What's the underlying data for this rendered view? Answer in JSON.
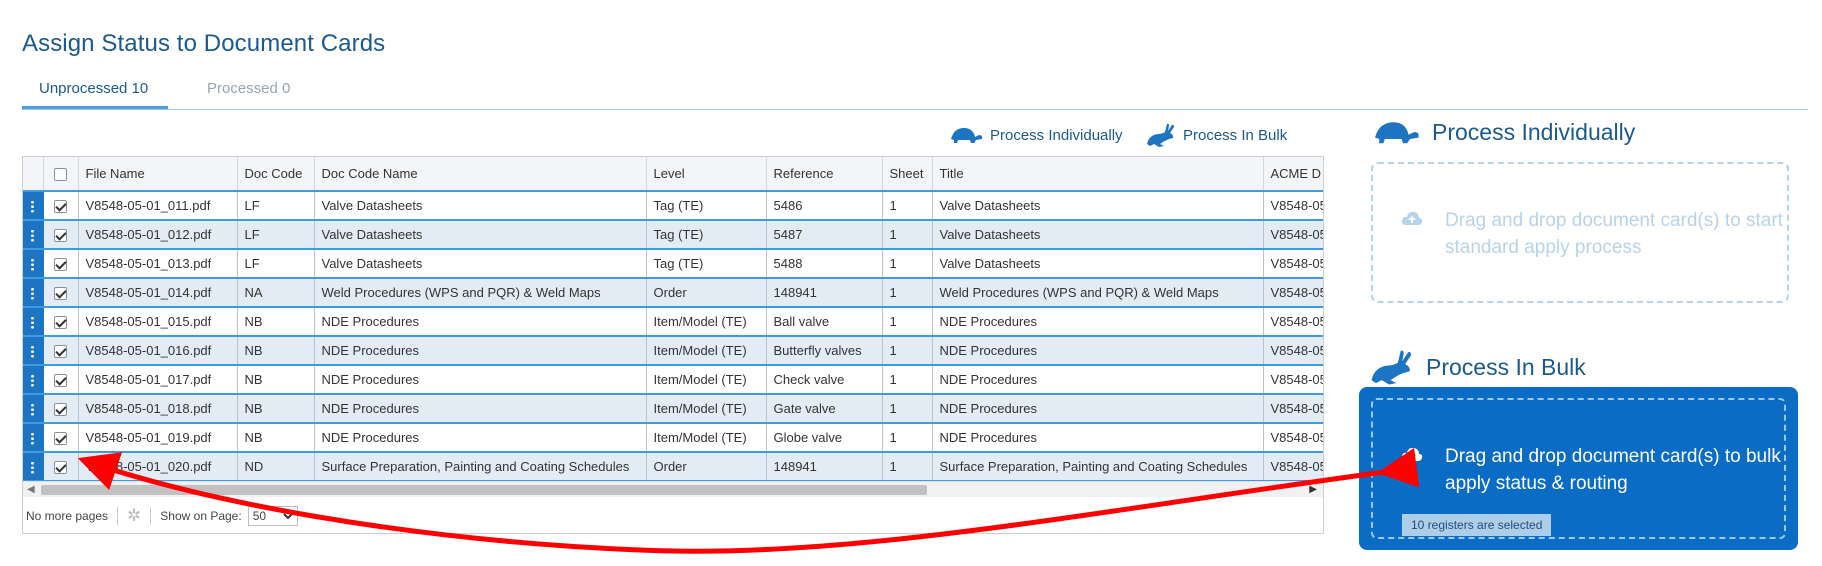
{
  "page": {
    "title": "Assign Status to Document Cards"
  },
  "tabs": [
    {
      "label": "Unprocessed 10",
      "active": true
    },
    {
      "label": "Processed 0",
      "active": false
    }
  ],
  "toolbar": {
    "process_individually": "Process Individually",
    "process_in_bulk": "Process In Bulk"
  },
  "grid": {
    "columns": [
      "File Name",
      "Doc Code",
      "Doc Code Name",
      "Level",
      "Reference",
      "Sheet",
      "Title",
      "ACME D"
    ],
    "rows": [
      {
        "file": "V8548-05-01_011.pdf",
        "code": "LF",
        "code_name": "Valve Datasheets",
        "level": "Tag (TE)",
        "reference": "5486",
        "sheet": "1",
        "title": "Valve Datasheets",
        "acme": "V8548-05"
      },
      {
        "file": "V8548-05-01_012.pdf",
        "code": "LF",
        "code_name": "Valve Datasheets",
        "level": "Tag (TE)",
        "reference": "5487",
        "sheet": "1",
        "title": "Valve Datasheets",
        "acme": "V8548-05"
      },
      {
        "file": "V8548-05-01_013.pdf",
        "code": "LF",
        "code_name": "Valve Datasheets",
        "level": "Tag (TE)",
        "reference": "5488",
        "sheet": "1",
        "title": "Valve Datasheets",
        "acme": "V8548-05"
      },
      {
        "file": "V8548-05-01_014.pdf",
        "code": "NA",
        "code_name": "Weld Procedures (WPS and PQR) & Weld Maps",
        "level": "Order",
        "reference": "148941",
        "sheet": "1",
        "title": "Weld Procedures (WPS and PQR) & Weld Maps",
        "acme": "V8548-05"
      },
      {
        "file": "V8548-05-01_015.pdf",
        "code": "NB",
        "code_name": "NDE Procedures",
        "level": "Item/Model (TE)",
        "reference": "Ball valve",
        "sheet": "1",
        "title": "NDE Procedures",
        "acme": "V8548-05"
      },
      {
        "file": "V8548-05-01_016.pdf",
        "code": "NB",
        "code_name": "NDE Procedures",
        "level": "Item/Model (TE)",
        "reference": "Butterfly valves",
        "sheet": "1",
        "title": "NDE Procedures",
        "acme": "V8548-05"
      },
      {
        "file": "V8548-05-01_017.pdf",
        "code": "NB",
        "code_name": "NDE Procedures",
        "level": "Item/Model (TE)",
        "reference": "Check valve",
        "sheet": "1",
        "title": "NDE Procedures",
        "acme": "V8548-05"
      },
      {
        "file": "V8548-05-01_018.pdf",
        "code": "NB",
        "code_name": "NDE Procedures",
        "level": "Item/Model (TE)",
        "reference": "Gate valve",
        "sheet": "1",
        "title": "NDE Procedures",
        "acme": "V8548-05"
      },
      {
        "file": "V8548-05-01_019.pdf",
        "code": "NB",
        "code_name": "NDE Procedures",
        "level": "Item/Model (TE)",
        "reference": "Globe valve",
        "sheet": "1",
        "title": "NDE Procedures",
        "acme": "V8548-05"
      },
      {
        "file": "V8548-05-01_020.pdf",
        "code": "ND",
        "code_name": "Surface Preparation, Painting and Coating Schedules",
        "level": "Order",
        "reference": "148941",
        "sheet": "1",
        "title": "Surface Preparation, Painting and Coating Schedules",
        "acme": "V8548-05"
      }
    ]
  },
  "pager": {
    "status": "No more pages",
    "show_label": "Show on Page:",
    "page_size": "50"
  },
  "panels": {
    "individual": {
      "title": "Process Individually",
      "drop_text": "Drag and drop document card(s) to start standard apply process"
    },
    "bulk": {
      "title": "Process In Bulk",
      "drop_text": "Drag and drop document card(s) to bulk apply status & routing",
      "selected_badge": "10 registers are selected"
    }
  },
  "colors": {
    "brand_blue": "#1b5a8c",
    "accent_blue": "#0a6cc4",
    "row_border": "#3c9cdf",
    "annotation_arrow": "#ff0000"
  },
  "icons": {
    "individual": "turtle-icon",
    "bulk": "rabbit-icon",
    "upload": "cloud-upload-icon"
  }
}
